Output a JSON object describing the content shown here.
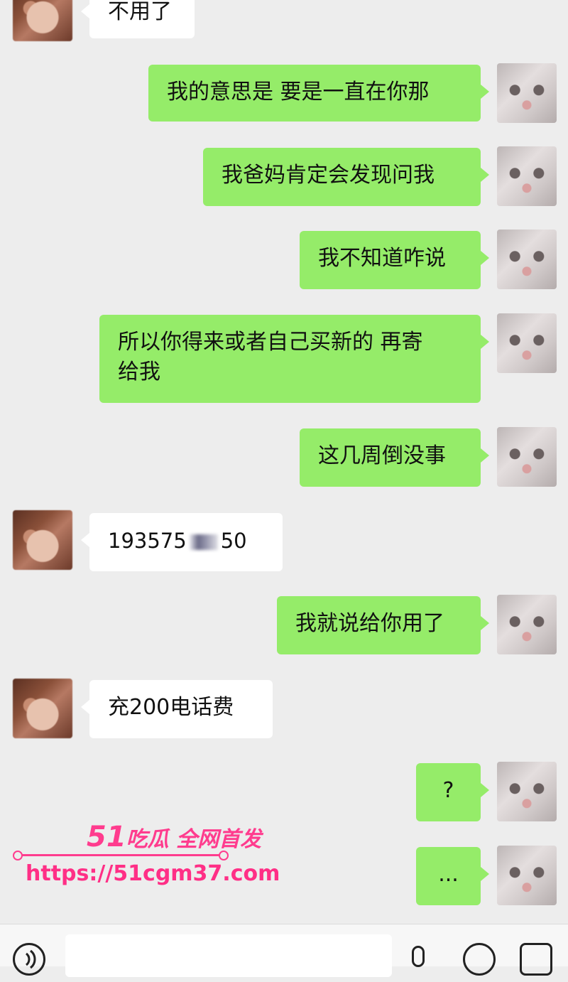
{
  "messages": [
    {
      "side": "left",
      "avatar": "girl",
      "text": "不用了"
    },
    {
      "side": "right",
      "avatar": "cat",
      "text": "我的意思是 要是一直在你那"
    },
    {
      "side": "right",
      "avatar": "cat",
      "text": "我爸妈肯定会发现问我"
    },
    {
      "side": "right",
      "avatar": "cat",
      "text": "我不知道咋说"
    },
    {
      "side": "right",
      "avatar": "cat",
      "text_line1": "所以你得来或者自己买新的 再寄",
      "text_line2": "给我"
    },
    {
      "side": "right",
      "avatar": "cat",
      "text": "这几周倒没事"
    },
    {
      "side": "left",
      "avatar": "girl",
      "text_start": "193575",
      "text_end": "50"
    },
    {
      "side": "right",
      "avatar": "cat",
      "text": "我就说给你用了"
    },
    {
      "side": "left",
      "avatar": "girl",
      "text": "充200电话费"
    },
    {
      "side": "right",
      "avatar": "cat",
      "text": "?"
    },
    {
      "side": "right",
      "avatar": "cat",
      "text": "..."
    }
  ],
  "watermark": {
    "brand_number": "51",
    "brand_text": "吃瓜 全网首发",
    "url": "https://51cgm37.com"
  },
  "input_bar": {
    "voice_icon": "voice-icon",
    "mic_icon": "mic-icon",
    "emoji_icon": "emoji-icon",
    "more_icon": "more-icon"
  },
  "colors": {
    "background": "#ededed",
    "sent_bubble": "#95ec69",
    "received_bubble": "#ffffff",
    "watermark": "#ff3c8e"
  }
}
